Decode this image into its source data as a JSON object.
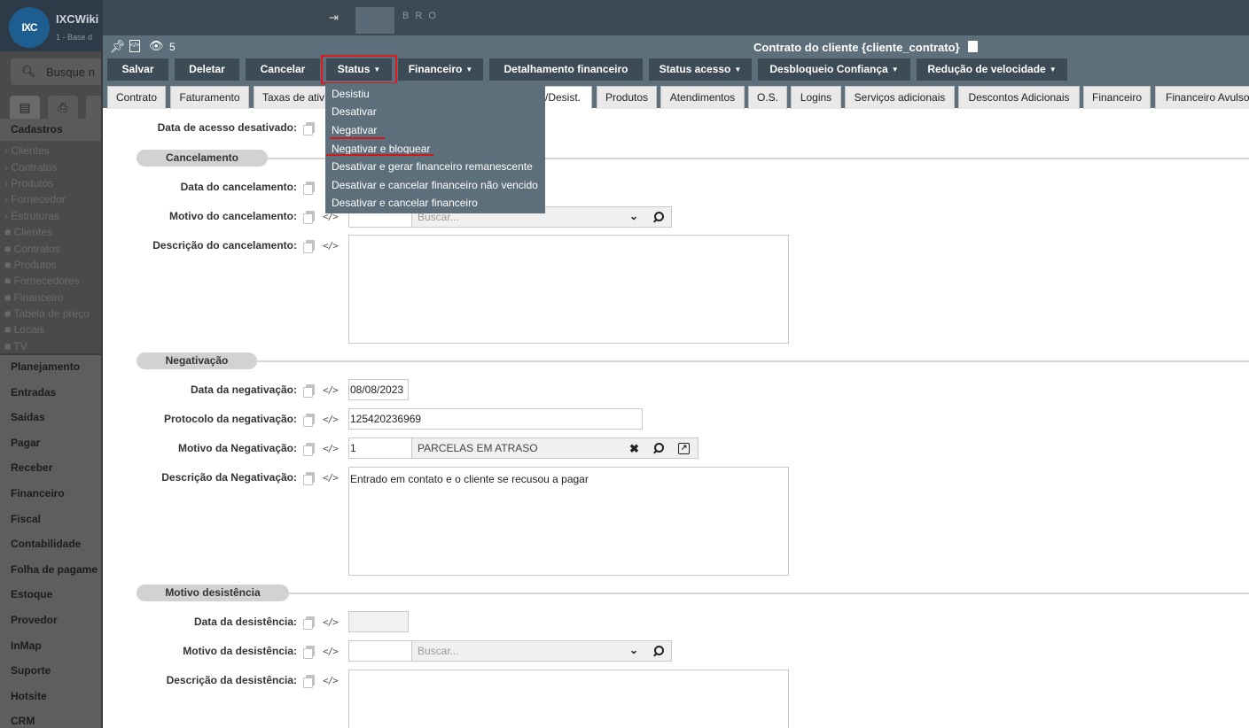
{
  "sidebar": {
    "logo": "IXC",
    "app_name": "IXCWiki",
    "app_sub": "1 - Base d",
    "search_placeholder": "Busque n",
    "section": "Cadastros",
    "sub_items": [
      "Clientes",
      "Contratos",
      "Produtos",
      "Fornecedor",
      "Estruturas"
    ],
    "folders": [
      "Clientes",
      "Contratos",
      "Produtos",
      "Fornecedores",
      "Financeiro",
      "Tabela de preço",
      "Locais",
      "TV"
    ],
    "main_items": [
      "Planejamento",
      "Entradas",
      "Saídas",
      "Pagar",
      "Receber",
      "Financeiro",
      "Fiscal",
      "Contabilidade",
      "Folha de pagame",
      "Estoque",
      "Provedor",
      "InMap",
      "Suporte",
      "Hotsite",
      "CRM"
    ]
  },
  "topbar": {
    "label": "B R O"
  },
  "modal": {
    "count": "5",
    "title": "Contrato do cliente {cliente_contrato}"
  },
  "toolbar": {
    "save": "Salvar",
    "delete": "Deletar",
    "cancel": "Cancelar",
    "status": "Status",
    "financeiro": "Financeiro",
    "detalhamento": "Detalhamento financeiro",
    "status_acesso": "Status acesso",
    "desbloqueio": "Desbloqueio Confiança",
    "reducao": "Redução de velocidade"
  },
  "tabs": [
    "Contrato",
    "Faturamento",
    "Taxas de ativ",
    "/Desist.",
    "Produtos",
    "Atendimentos",
    "O.S.",
    "Logins",
    "Serviços adicionais",
    "Descontos Adicionais",
    "Financeiro",
    "Financeiro Avulso"
  ],
  "status_menu": [
    "Desistiu",
    "Desativar",
    "Negativar",
    "Negativar e bloquear",
    "Desativar e gerar financeiro remanescente",
    "Desativar e cancelar financeiro não vencido",
    "Desativar e cancelar financeiro"
  ],
  "form": {
    "data_acesso_desativado_label": "Data de acesso desativado:",
    "cancelamento": {
      "title": "Cancelamento",
      "data_label": "Data do cancelamento:",
      "motivo_label": "Motivo do cancelamento:",
      "motivo_placeholder": "Buscar...",
      "descricao_label": "Descrição do cancelamento:"
    },
    "negativacao": {
      "title": "Negativação",
      "data_label": "Data da negativação:",
      "data_value": "08/08/2023",
      "protocolo_label": "Protocolo da negativação:",
      "protocolo_value": "125420236969",
      "motivo_label": "Motivo da Negativação:",
      "motivo_id": "1",
      "motivo_text": "PARCELAS EM ATRASO",
      "descricao_label": "Descrição da Negativação:",
      "descricao_value": "Entrado em contato e o cliente se recusou a pagar"
    },
    "desistencia": {
      "title": "Motivo desistência",
      "data_label": "Data da desistência:",
      "motivo_label": "Motivo da desistência:",
      "motivo_placeholder": "Buscar...",
      "descricao_label": "Descrição da desistência:"
    }
  },
  "colors": {
    "toolbar_button": "#3d4b56",
    "header_bg": "#5e6f7c",
    "highlight": "#e0191f"
  }
}
